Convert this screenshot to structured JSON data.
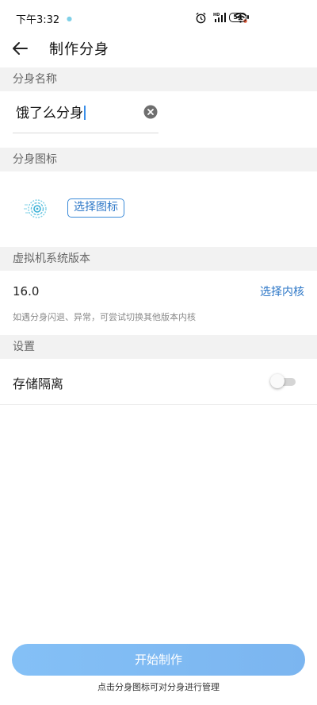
{
  "status_bar": {
    "time": "下午3:32",
    "battery_level": "54",
    "icons": [
      "alarm-icon",
      "hd-signal-icon",
      "wifi-icon",
      "battery-icon"
    ]
  },
  "header": {
    "title": "制作分身"
  },
  "name_section": {
    "header": "分身名称",
    "input_value": "饿了么分身"
  },
  "icon_section": {
    "header": "分身图标",
    "choose_label": "选择图标"
  },
  "version_section": {
    "header": "虚拟机系统版本",
    "value": "16.0",
    "choose_kernel": "选择内核",
    "hint": "如遇分身闪退、异常，可尝试切换其他版本内核"
  },
  "settings_section": {
    "header": "设置",
    "storage_isolation": "存储隔离",
    "storage_isolation_enabled": false
  },
  "footer": {
    "start_button": "开始制作",
    "hint": "点击分身图标可对分身进行管理"
  },
  "colors": {
    "accent": "#2d77c7",
    "button_bg": "#7bb5f0",
    "section_bg": "#f2f2f2"
  }
}
